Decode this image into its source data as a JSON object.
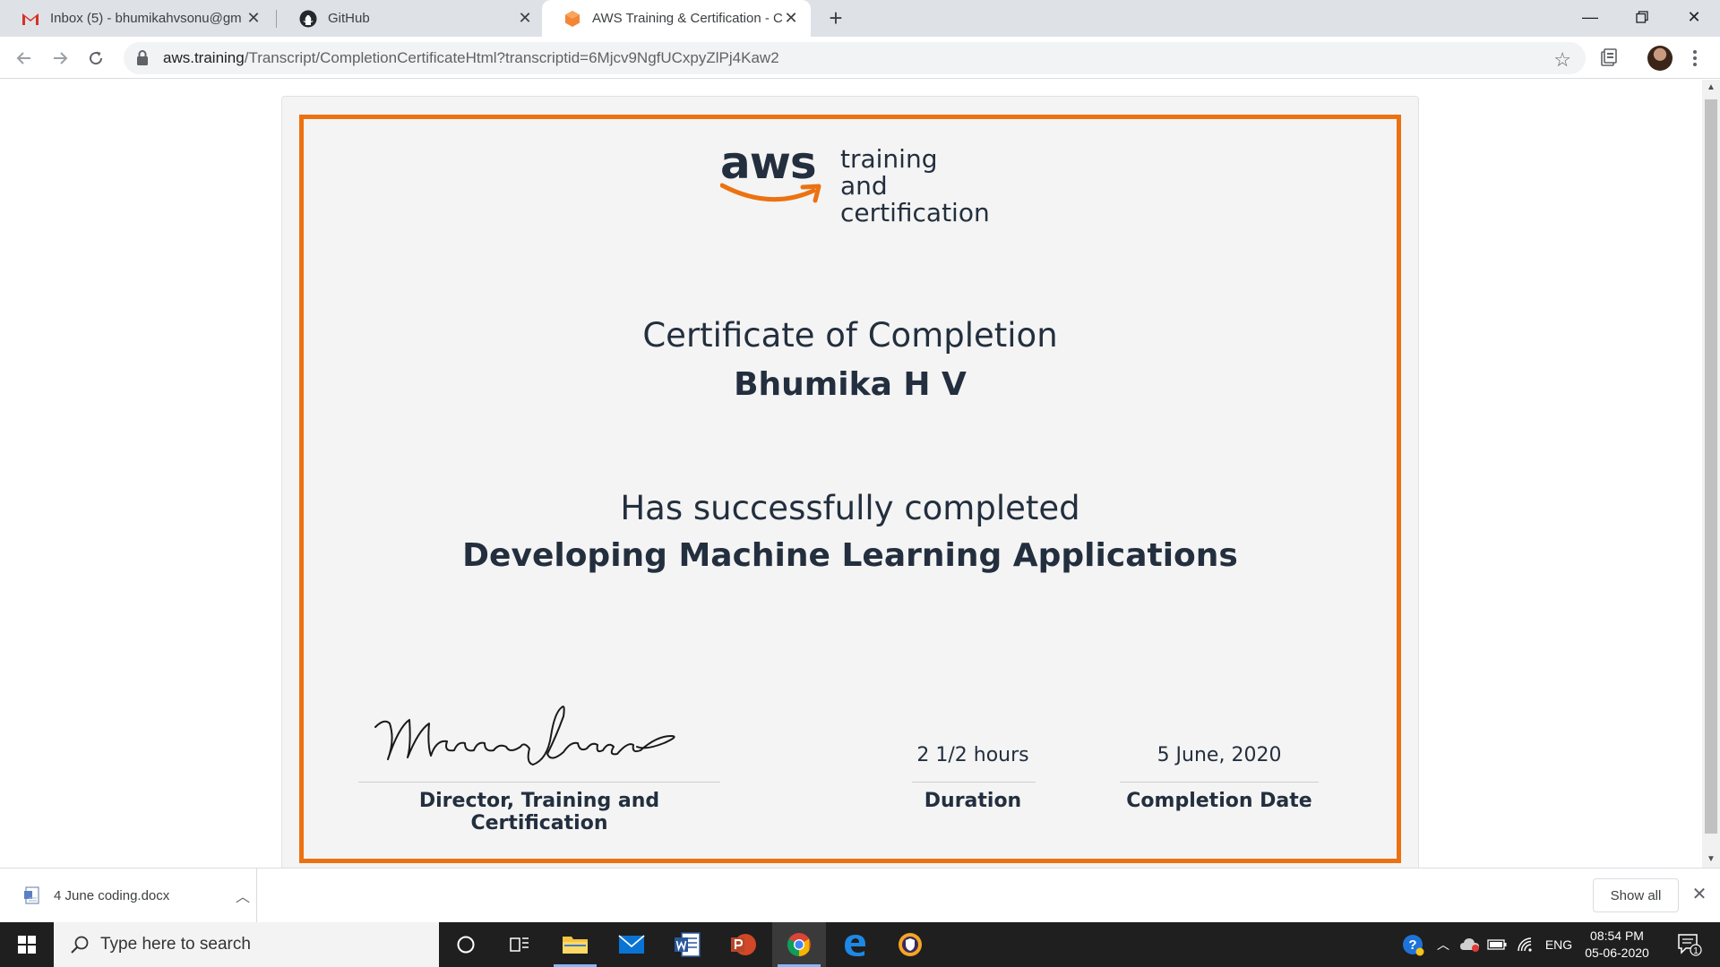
{
  "browser": {
    "tabs": [
      {
        "title": "Inbox (5) - bhumikahvsonu@gm",
        "icon": "gmail-icon"
      },
      {
        "title": "GitHub",
        "icon": "github-icon"
      },
      {
        "title": "AWS Training & Certification - Ce",
        "icon": "aws-icon",
        "active": true
      }
    ],
    "url_host": "aws.training",
    "url_rest": "/Transcript/CompletionCertificateHtml?transcriptid=6Mjcv9NgfUCxpyZlPj4Kaw2"
  },
  "certificate": {
    "logo_word": "aws",
    "logo_line1": "training and",
    "logo_line2": "certification",
    "title": "Certificate of Completion",
    "recipient": "Bhumika H V",
    "completed_text": "Has successfully completed",
    "course": "Developing Machine Learning Applications",
    "signature_role": "Director, Training and Certification",
    "duration_value": "2 1/2 hours",
    "duration_label": "Duration",
    "date_value": "5 June, 2020",
    "date_label": "Completion Date",
    "accent_color": "#ec7211"
  },
  "downloads": {
    "file": "4 June coding.docx",
    "show_all": "Show all"
  },
  "taskbar": {
    "search_placeholder": "Type here to search",
    "language": "ENG",
    "time": "08:54 PM",
    "date": "05-06-2020",
    "notifications": "1"
  }
}
